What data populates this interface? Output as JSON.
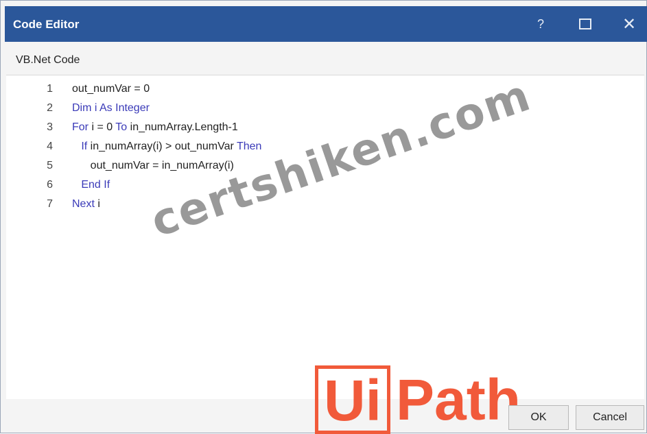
{
  "window": {
    "title": "Code Editor",
    "help_label": "?",
    "close_label": "✕"
  },
  "editor": {
    "label": "VB.Net Code",
    "lines": [
      {
        "num": "1",
        "parts": [
          {
            "text": "out_numVar = 0",
            "kw": false
          }
        ]
      },
      {
        "num": "2",
        "parts": [
          {
            "text": "Dim i As Integer",
            "kw": true
          }
        ]
      },
      {
        "num": "3",
        "parts": [
          {
            "text": "For",
            "kw": true
          },
          {
            "text": " i = 0 ",
            "kw": false
          },
          {
            "text": "To",
            "kw": true
          },
          {
            "text": " in_numArray.Length-1",
            "kw": false
          }
        ]
      },
      {
        "num": "4",
        "parts": [
          {
            "text": "   If",
            "kw": true
          },
          {
            "text": " in_numArray(i) > out_numVar ",
            "kw": false
          },
          {
            "text": "Then",
            "kw": true
          }
        ]
      },
      {
        "num": "5",
        "parts": [
          {
            "text": "      out_numVar = in_numArray(i)",
            "kw": false
          }
        ]
      },
      {
        "num": "6",
        "parts": [
          {
            "text": "   End If",
            "kw": true
          }
        ]
      },
      {
        "num": "7",
        "parts": [
          {
            "text": "Next",
            "kw": true
          },
          {
            "text": " i",
            "kw": false
          }
        ]
      }
    ]
  },
  "watermark": {
    "text": "certshiken.com"
  },
  "logo": {
    "ui": "Ui",
    "path": "Path",
    "color": "#f15a3a"
  },
  "buttons": {
    "ok": "OK",
    "cancel": "Cancel"
  },
  "colors": {
    "titlebar": "#2b579a",
    "keyword": "#3a3ab8"
  }
}
